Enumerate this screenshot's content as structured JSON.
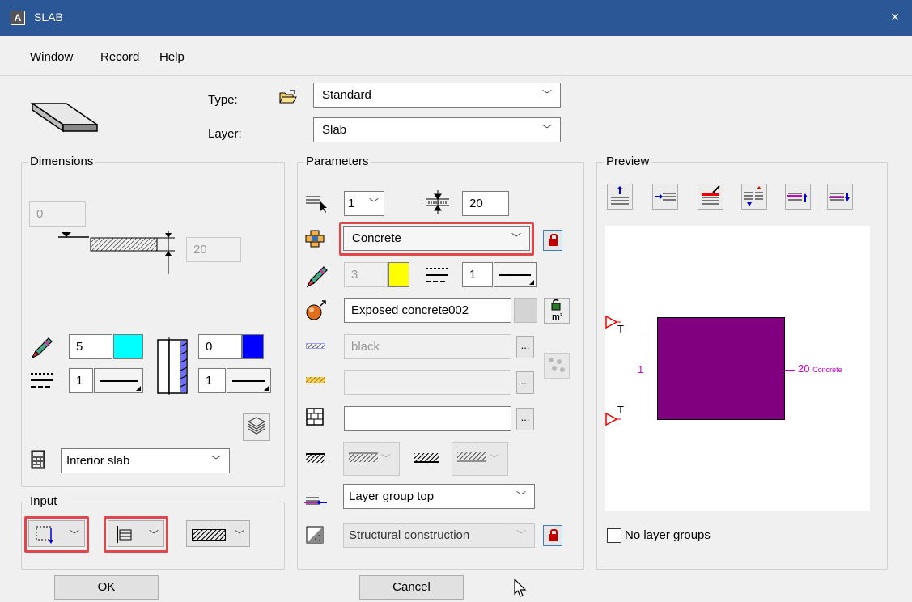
{
  "window": {
    "title": "SLAB",
    "close": "×"
  },
  "menu": [
    "Window",
    "Record",
    "Help"
  ],
  "header": {
    "type_label": "Type:",
    "type_value": "Standard",
    "layer_label": "Layer:",
    "layer_value": "Slab"
  },
  "dimensions": {
    "title": "Dimensions",
    "top_offset": "0",
    "thickness": "20",
    "pen_left": "5",
    "pen_right": "0",
    "line_left": "1",
    "line_right": "1",
    "preset": "Interior slab",
    "colors": {
      "left": "#00ffff",
      "right": "#0000ff"
    }
  },
  "parameters": {
    "title": "Parameters",
    "layer_index": "1",
    "thickness": "20",
    "material": "Concrete",
    "pen": "3",
    "line_type": "1",
    "surface": "Exposed concrete002",
    "hatch": "black",
    "fill": "",
    "pattern": "",
    "layer_group": "Layer group top",
    "construction": "Structural construction",
    "colors": {
      "pen": "#ffff00",
      "highlight": "#e0474c"
    }
  },
  "preview": {
    "title": "Preview",
    "left_label": "1",
    "right_label": "20",
    "material_label": "Concrete",
    "marker": "T",
    "no_layer_groups_label": "No layer groups",
    "no_layer_groups_checked": false,
    "colors": {
      "fill": "#800080",
      "label": "#cc00cc"
    }
  },
  "input": {
    "title": "Input"
  },
  "buttons": {
    "ok": "OK",
    "cancel": "Cancel"
  }
}
